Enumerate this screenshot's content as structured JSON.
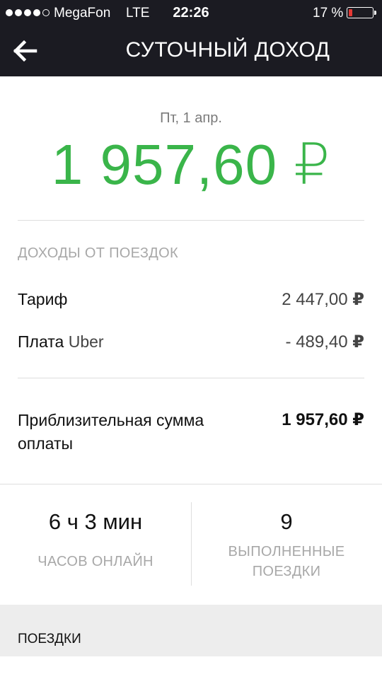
{
  "status_bar": {
    "carrier": "MegaFon",
    "network": "LTE",
    "time": "22:26",
    "battery_percent": "17 %",
    "battery_level": 0.17,
    "signal_bars": 4,
    "signal_total": 5
  },
  "header": {
    "title": "СУТОЧНЫЙ ДОХОД",
    "back_icon": "arrow-left-icon",
    "background": "#1b1b22"
  },
  "summary": {
    "date": "Пт, 1 апр.",
    "total": "1 957,60 ₽",
    "accent": "#3ab54a"
  },
  "earnings": {
    "section_label": "ДОХОДЫ ОТ ПОЕЗДОК",
    "fare_label": "Тариф",
    "fare_value": "2 447,00",
    "fee_label_a": "Плата",
    "fee_label_b": "Uber",
    "fee_value": "- 489,40",
    "currency": "₽",
    "payout_label": "Приблизительная сумма оплаты",
    "payout_value": "1 957,60"
  },
  "stats": {
    "online_value": "6 ч 3 мин",
    "online_label": "ЧАСОВ ОНЛАЙН",
    "trips_value": "9",
    "trips_label": "ВЫПОЛНЕННЫЕ ПОЕЗДКИ"
  },
  "trips_section": {
    "label": "ПОЕЗДКИ"
  }
}
